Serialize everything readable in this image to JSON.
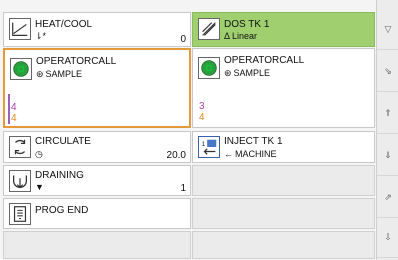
{
  "steps": {
    "heat_cool": {
      "name": "HEAT/COOL",
      "sub_icon": "⇂*",
      "value": "0"
    },
    "dos_tk1": {
      "name": "DOS TK 1",
      "sub_icon": "Δ",
      "sub_text": "Linear"
    },
    "operatorcall_left": {
      "name": "OPERATORCALL",
      "sub_icon": "⊛",
      "sub_text": "SAMPLE",
      "tag_top": "4",
      "tag_bottom": "4"
    },
    "operatorcall_right": {
      "name": "OPERATORCALL",
      "sub_icon": "⊛",
      "sub_text": "SAMPLE",
      "tag_top": "3",
      "tag_bottom": "4"
    },
    "circulate": {
      "name": "CIRCULATE",
      "sub_icon": "◷",
      "value": "20.0"
    },
    "inject_tk1": {
      "name": "INJECT TK 1",
      "sub_icon": "←",
      "sub_text": "MACHINE"
    },
    "draining": {
      "name": "DRAINING",
      "sub_icon": "▼",
      "value": "1"
    },
    "prog_end": {
      "name": "PROG END"
    }
  },
  "side_buttons": [
    "▽",
    "⇘",
    "⇑",
    "⇓",
    "⇗",
    "⇩"
  ],
  "colors": {
    "highlight": "#e39a3a",
    "active": "#9fcf6f",
    "tag_purple": "#b040b0",
    "tag_orange": "#e08a1a"
  },
  "icons": {
    "heat_cool": "line-chart-icon",
    "dos_tk1": "linear-ramp-icon",
    "operatorcall": "green-gear-icon",
    "circulate": "circulate-arrows-icon",
    "inject": "inject-tank-icon",
    "draining": "drain-funnel-icon",
    "prog_end": "document-icon"
  }
}
